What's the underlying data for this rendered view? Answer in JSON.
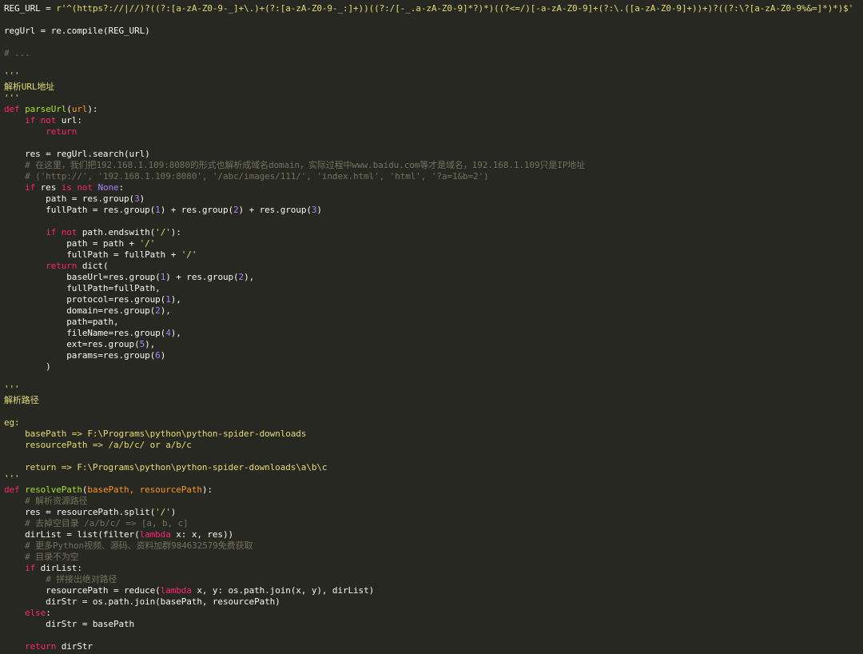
{
  "colors": {
    "background": "#272822",
    "plain": "#f8f8f2",
    "keyword": "#f92672",
    "function": "#a6e22e",
    "parameter": "#fd971f",
    "string": "#e6db74",
    "number": "#ae81ff",
    "comment": "#75715e"
  },
  "lines": [
    [
      [
        "plain",
        "REG_URL = "
      ],
      [
        "str",
        "r'^(https?://|//)?((?:[a-zA-Z0-9-_]+\\.)+(?:[a-zA-Z0-9-_:]+))((?:/[-_.a-zA-Z0-9]*?)*)((?<=/)[-a-zA-Z0-9]+(?:\\.([a-zA-Z0-9]+))+)?((?:\\?[a-zA-Z0-9%&=]*)*)$'"
      ]
    ],
    [],
    [
      [
        "plain",
        "regUrl = re.compile(REG_URL)"
      ]
    ],
    [],
    [
      [
        "comment",
        "# ..."
      ]
    ],
    [],
    [
      [
        "str",
        "'''"
      ]
    ],
    [
      [
        "str",
        "解析URL地址"
      ]
    ],
    [
      [
        "str",
        "'''"
      ]
    ],
    [
      [
        "def",
        "def "
      ],
      [
        "fn",
        "parseUrl"
      ],
      [
        "plain",
        "("
      ],
      [
        "param",
        "url"
      ],
      [
        "plain",
        "):"
      ]
    ],
    [
      [
        "plain",
        "    "
      ],
      [
        "kw",
        "if not"
      ],
      [
        "plain",
        " url:"
      ]
    ],
    [
      [
        "plain",
        "        "
      ],
      [
        "kw",
        "return"
      ]
    ],
    [],
    [
      [
        "plain",
        "    res = regUrl.search(url)"
      ]
    ],
    [
      [
        "plain",
        "    "
      ],
      [
        "comment",
        "# 在这里，我们把192.168.1.109:8080的形式也解析成域名domain，实际过程中www.baidu.com等才是域名，192.168.1.109只是IP地址"
      ]
    ],
    [
      [
        "plain",
        "    "
      ],
      [
        "comment",
        "# ('http://', '192.168.1.109:8080', '/abc/images/111/', 'index.html', 'html', '?a=1&b=2')"
      ]
    ],
    [
      [
        "plain",
        "    "
      ],
      [
        "kw",
        "if"
      ],
      [
        "plain",
        " res "
      ],
      [
        "kw",
        "is not"
      ],
      [
        "plain",
        " "
      ],
      [
        "const",
        "None"
      ],
      [
        "plain",
        ":"
      ]
    ],
    [
      [
        "plain",
        "        path = res.group("
      ],
      [
        "num",
        "3"
      ],
      [
        "plain",
        ")"
      ]
    ],
    [
      [
        "plain",
        "        fullPath = res.group("
      ],
      [
        "num",
        "1"
      ],
      [
        "plain",
        ") + res.group("
      ],
      [
        "num",
        "2"
      ],
      [
        "plain",
        ") + res.group("
      ],
      [
        "num",
        "3"
      ],
      [
        "plain",
        ")"
      ]
    ],
    [],
    [
      [
        "plain",
        "        "
      ],
      [
        "kw",
        "if not"
      ],
      [
        "plain",
        " path.endswith("
      ],
      [
        "str",
        "'/'"
      ],
      [
        "plain",
        "):"
      ]
    ],
    [
      [
        "plain",
        "            path = path + "
      ],
      [
        "str",
        "'/'"
      ]
    ],
    [
      [
        "plain",
        "            fullPath = fullPath + "
      ],
      [
        "str",
        "'/'"
      ]
    ],
    [
      [
        "plain",
        "        "
      ],
      [
        "kw",
        "return"
      ],
      [
        "plain",
        " dict("
      ]
    ],
    [
      [
        "plain",
        "            baseUrl=res.group("
      ],
      [
        "num",
        "1"
      ],
      [
        "plain",
        ") + res.group("
      ],
      [
        "num",
        "2"
      ],
      [
        "plain",
        "),"
      ]
    ],
    [
      [
        "plain",
        "            fullPath=fullPath,"
      ]
    ],
    [
      [
        "plain",
        "            protocol=res.group("
      ],
      [
        "num",
        "1"
      ],
      [
        "plain",
        "),"
      ]
    ],
    [
      [
        "plain",
        "            domain=res.group("
      ],
      [
        "num",
        "2"
      ],
      [
        "plain",
        "),"
      ]
    ],
    [
      [
        "plain",
        "            path=path,"
      ]
    ],
    [
      [
        "plain",
        "            fileName=res.group("
      ],
      [
        "num",
        "4"
      ],
      [
        "plain",
        "),"
      ]
    ],
    [
      [
        "plain",
        "            ext=res.group("
      ],
      [
        "num",
        "5"
      ],
      [
        "plain",
        "),"
      ]
    ],
    [
      [
        "plain",
        "            params=res.group("
      ],
      [
        "num",
        "6"
      ],
      [
        "plain",
        ")"
      ]
    ],
    [
      [
        "plain",
        "        )"
      ]
    ],
    [],
    [
      [
        "str",
        "'''"
      ]
    ],
    [
      [
        "str",
        "解析路径"
      ]
    ],
    [],
    [
      [
        "str",
        "eg:"
      ]
    ],
    [
      [
        "str",
        "    basePath => F:\\Programs\\python\\python-spider-downloads"
      ]
    ],
    [
      [
        "str",
        "    resourcePath => /a/b/c/ or a/b/c"
      ]
    ],
    [],
    [
      [
        "str",
        "    return => F:\\Programs\\python\\python-spider-downloads\\a\\b\\c"
      ]
    ],
    [
      [
        "str",
        "'''"
      ]
    ],
    [
      [
        "def",
        "def "
      ],
      [
        "fn",
        "resolvePath"
      ],
      [
        "plain",
        "("
      ],
      [
        "param",
        "basePath, resourcePath"
      ],
      [
        "plain",
        "):"
      ]
    ],
    [
      [
        "plain",
        "    "
      ],
      [
        "comment",
        "# 解析资源路径"
      ]
    ],
    [
      [
        "plain",
        "    res = resourcePath.split("
      ],
      [
        "str",
        "'/'"
      ],
      [
        "plain",
        ")"
      ]
    ],
    [
      [
        "plain",
        "    "
      ],
      [
        "comment",
        "# 去掉空目录 /a/b/c/ => [a, b, c]"
      ]
    ],
    [
      [
        "plain",
        "    dirList = list(filter("
      ],
      [
        "kw",
        "lambda"
      ],
      [
        "plain",
        " x: x, res))"
      ]
    ],
    [
      [
        "plain",
        "    "
      ],
      [
        "comment",
        "# 更多Python视频、源码、资料加群984632579免费获取"
      ]
    ],
    [
      [
        "plain",
        "    "
      ],
      [
        "comment",
        "# 目录不为空"
      ]
    ],
    [
      [
        "plain",
        "    "
      ],
      [
        "kw",
        "if"
      ],
      [
        "plain",
        " dirList:"
      ]
    ],
    [
      [
        "plain",
        "        "
      ],
      [
        "comment",
        "# 拼接出绝对路径"
      ]
    ],
    [
      [
        "plain",
        "        resourcePath = reduce("
      ],
      [
        "kw",
        "lambda"
      ],
      [
        "plain",
        " x, y: os.path.join(x, y), dirList)"
      ]
    ],
    [
      [
        "plain",
        "        dirStr = os.path.join(basePath, resourcePath)"
      ]
    ],
    [
      [
        "plain",
        "    "
      ],
      [
        "kw",
        "else"
      ],
      [
        "plain",
        ":"
      ]
    ],
    [
      [
        "plain",
        "        dirStr = basePath"
      ]
    ],
    [],
    [
      [
        "plain",
        "    "
      ],
      [
        "kw",
        "return"
      ],
      [
        "plain",
        " dirStr"
      ]
    ]
  ]
}
